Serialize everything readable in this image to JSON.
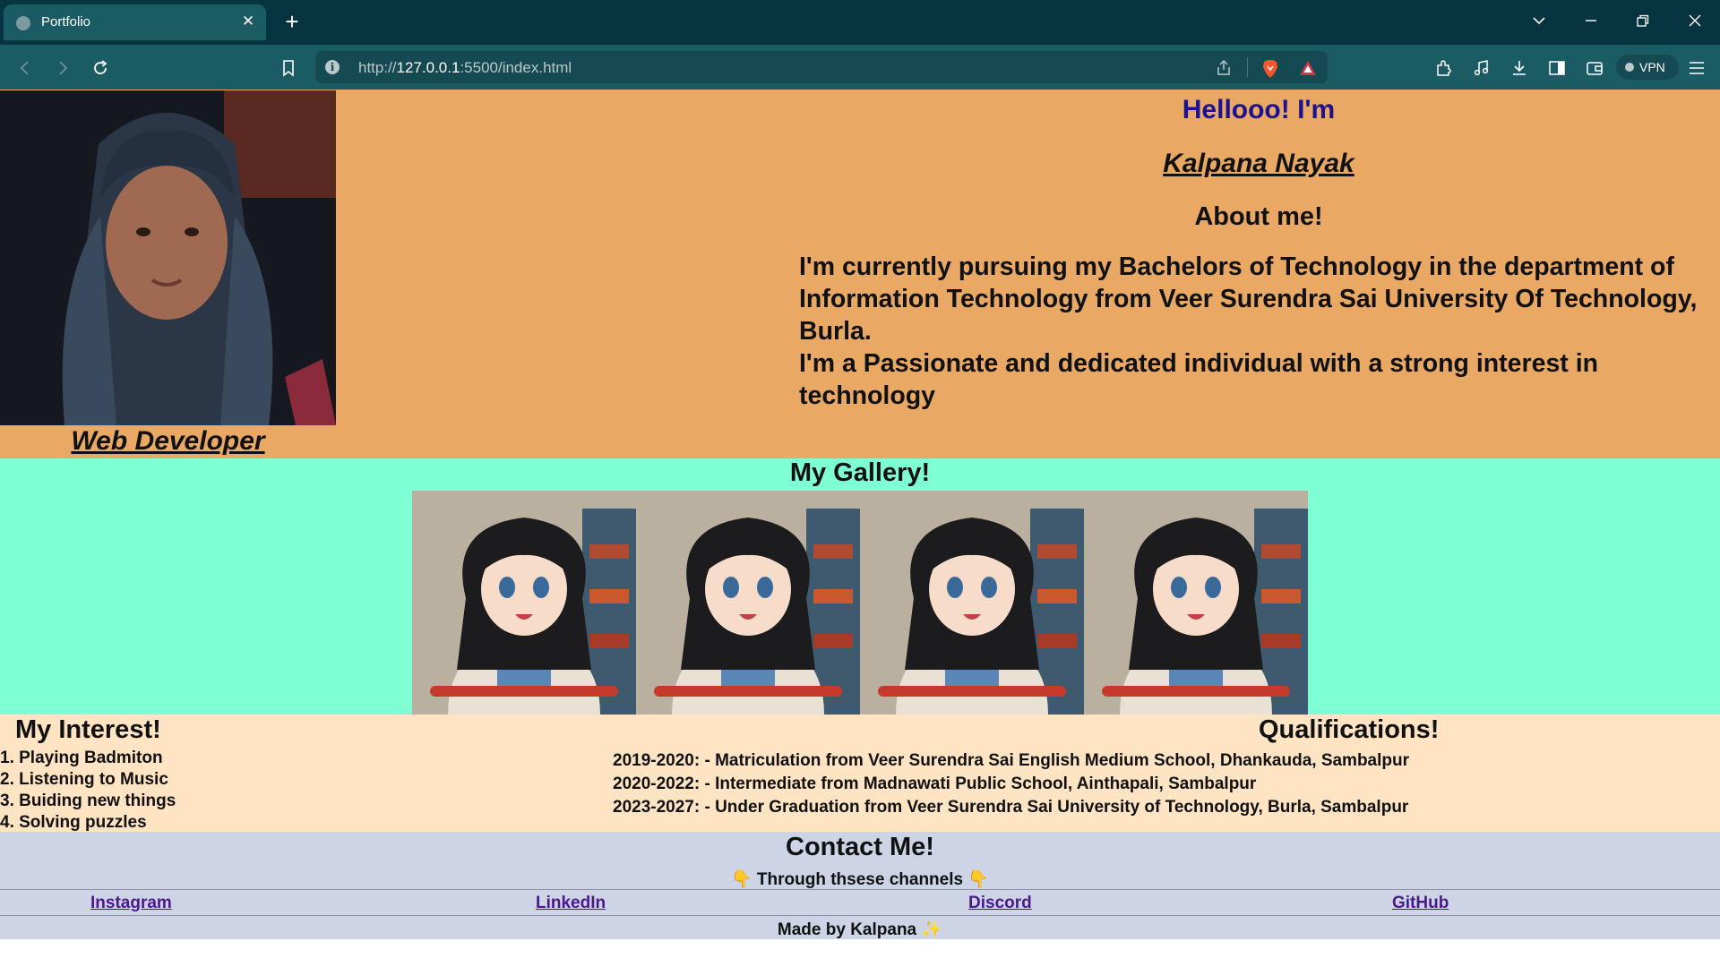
{
  "browser": {
    "tab_title": "Portfolio",
    "tab_close": "✕",
    "new_tab": "+",
    "url_prefix": "http://",
    "url_host": "127.0.0.1",
    "url_rest": ":5500/index.html",
    "vpn_label": "VPN"
  },
  "hero": {
    "greeting": "Hellooo! I'm",
    "name": "Kalpana Nayak",
    "role": "Web Developer",
    "about_title": "About me!",
    "about_line1": "I'm currently pursuing my Bachelors of Technology in the department of Information Technology from Veer Surendra Sai University Of Technology, Burla.",
    "about_line2": "I'm a Passionate and dedicated individual with a strong interest in technology"
  },
  "gallery": {
    "title": "My Gallery!"
  },
  "interests": {
    "title": "My Interest!",
    "items": [
      "1. Playing Badmiton",
      "2. Listening to Music",
      "3. Buiding new things",
      "4. Solving puzzles"
    ]
  },
  "qualifications": {
    "title": "Qualifications!",
    "items": [
      "2019-2020: - Matriculation from Veer Surendra Sai English Medium School, Dhankauda, Sambalpur",
      "2020-2022: - Intermediate from Madnawati Public School, Ainthapali, Sambalpur",
      "2023-2027: - Under Graduation from Veer Surendra Sai University of Technology, Burla, Sambalpur"
    ]
  },
  "contact": {
    "title": "Contact Me!",
    "subtitle": "Through thsese channels",
    "links": [
      "Instagram",
      "LinkedIn",
      "Discord",
      "GitHub"
    ],
    "made_by": "Made by Kalpana"
  }
}
